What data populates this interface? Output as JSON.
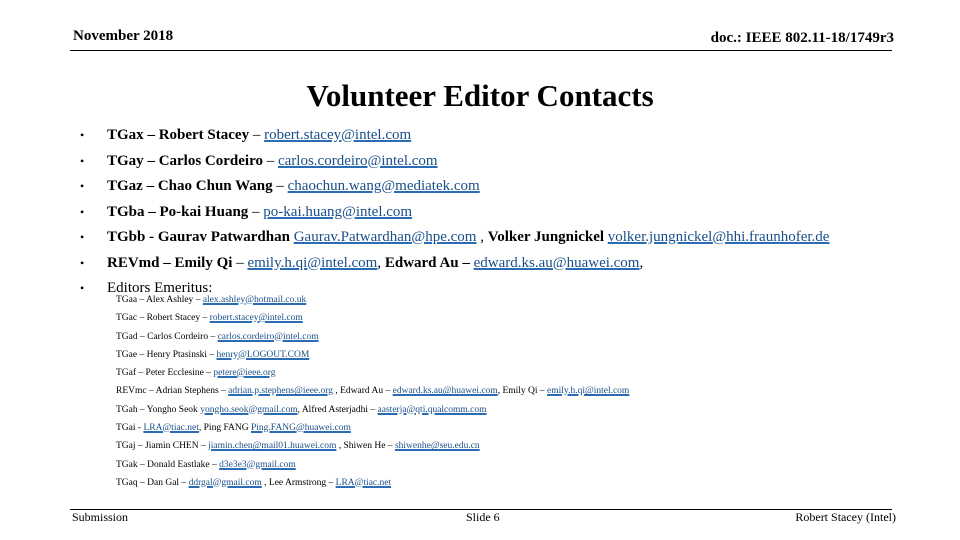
{
  "header": {
    "date": "November 2018",
    "doc": "doc.: IEEE 802.11-18/1749r3"
  },
  "title": "Volunteer Editor Contacts",
  "bullets": [
    {
      "group": "TGax",
      "sep": " – ",
      "name": "Robert Stacey",
      "dash": " – ",
      "email": "robert.stacey@intel.com"
    },
    {
      "group": "TGay",
      "sep": " – ",
      "name": "Carlos Cordeiro",
      "dash": " – ",
      "email": "carlos.cordeiro@intel.com"
    },
    {
      "group": "TGaz",
      "sep": " – ",
      "name": "Chao Chun Wang",
      "dash": " – ",
      "email": "chaochun.wang@mediatek.com"
    },
    {
      "group": "TGba",
      "sep": " – ",
      "name": "Po-kai Huang",
      "dash": " – ",
      "email": "po-kai.huang@intel.com"
    },
    {
      "group": "TGbb",
      "sep": " - ",
      "name": "Gaurav Patwardhan",
      "dash": " ",
      "email": "Gaurav.Patwardhan@hpe.com",
      "name2": "Volker Jungnickel",
      "email2": "volker.jungnickel@hhi.fraunhofer.de"
    },
    {
      "group": "REVmd",
      "sep": " – ",
      "name": "Emily Qi",
      "dash": " – ",
      "email": "emily.h.qi@intel.com",
      "name2": "Edward Au",
      "email2": "edward.ks.au@huawei.com"
    },
    {
      "label": "Editors Emeritus:"
    }
  ],
  "emeritus": [
    {
      "text": "TGaa – Alex Ashley – ",
      "email": "alex.ashley@hotmail.co.uk"
    },
    {
      "text": "TGac – Robert Stacey – ",
      "email": "robert.stacey@intel.com"
    },
    {
      "text": "TGad – Carlos Cordeiro – ",
      "email": "carlos.cordeiro@intel.com"
    },
    {
      "text": "TGae – Henry Ptasinski – ",
      "email": "henry@LOGOUT.COM"
    },
    {
      "text": "TGaf – Peter Ecclesine – ",
      "email": "petere@ieee.org"
    },
    {
      "text": "REVmc – Adrian Stephens – ",
      "email": "adrian.p.stephens@ieee.org",
      "text2": " , Edward Au – ",
      "email2": "edward.ks.au@huawei.com",
      "text3": ", Emily Qi – ",
      "email3": "emily.h.qi@intel.com"
    },
    {
      "text": "TGah – Yongho Seok ",
      "email": "yongho.seok@gmail.com",
      "text2": ", Alfred Asterjadhi – ",
      "email2": "aasterja@qti.qualcomm.com"
    },
    {
      "text": "TGai - ",
      "email": "LRA@tiac.net",
      "text2": ", Ping FANG ",
      "email2": "Ping.FANG@huawei.com"
    },
    {
      "text": "TGaj – Jiamin CHEN – ",
      "email": "jiamin.chen@mail01.huawei.com",
      "text2": " , Shiwen He – ",
      "email2": "shiwenhe@seu.edu.cn"
    },
    {
      "text": "TGak – Donald Eastlake – ",
      "email": "d3e3e3@gmail.com"
    },
    {
      "text": "TGaq – Dan Gal – ",
      "email": "ddrgal@gmail.com",
      "text2": " , Lee Armstrong – ",
      "email2": "LRA@tiac.net"
    }
  ],
  "footer": {
    "left": "Submission",
    "center": "Slide 6",
    "right": "Robert Stacey (Intel)"
  },
  "colors": {
    "link": "#1a4f8a",
    "link_underline": "#2a6db5"
  },
  "bullet_glyph": "•"
}
